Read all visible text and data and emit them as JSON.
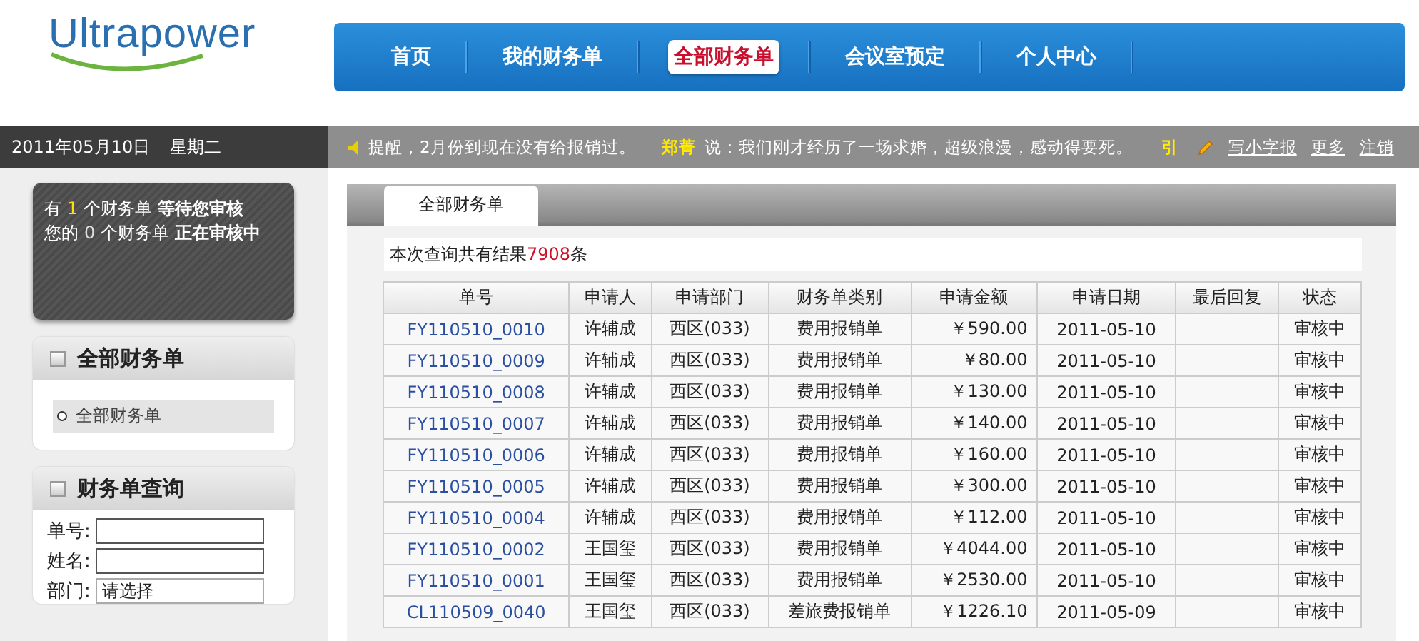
{
  "logo": {
    "text": "Ultrapower"
  },
  "nav": [
    {
      "label": "首页",
      "selected": false
    },
    {
      "label": "我的财务单",
      "selected": false
    },
    {
      "label": "全部财务单",
      "selected": true
    },
    {
      "label": "会议室预定",
      "selected": false
    },
    {
      "label": "个人中心",
      "selected": false
    }
  ],
  "date_bar": {
    "date": "2011年05月10日",
    "weekday": "星期二"
  },
  "notice": {
    "reminder": "提醒，2月份到现在没有给报销过。",
    "author": "郑菁",
    "message": "说：我们刚才经历了一场求婚，超级浪漫，感动得要死。",
    "marker": "引"
  },
  "notice_links": [
    "写小字报",
    "更多",
    "注销"
  ],
  "summary": [
    {
      "prefix": "有",
      "count": "1",
      "highlighted": true,
      "middle": "个财务单",
      "status": "等待您审核"
    },
    {
      "prefix": "您的",
      "count": "0",
      "highlighted": false,
      "middle": "个财务单",
      "status": "正在审核中"
    }
  ],
  "sidebar_all": {
    "title": "全部财务单",
    "items": [
      {
        "label": "全部财务单",
        "selected": true
      }
    ]
  },
  "sidebar_query": {
    "title": "财务单查询",
    "fields": [
      {
        "kind": "text",
        "label": "单号:"
      },
      {
        "kind": "text",
        "label": "姓名:"
      },
      {
        "kind": "select",
        "label": "部门:",
        "value": "请选择"
      }
    ]
  },
  "content": {
    "tab": "全部财务单",
    "result": {
      "prefix": "本次查询共有结果",
      "count": "7908",
      "suffix": "条"
    }
  },
  "table": {
    "columns": [
      "单号",
      "申请人",
      "申请部门",
      "财务单类别",
      "申请金额",
      "申请日期",
      "最后回复",
      "状态"
    ],
    "rows": [
      [
        "FY110510_0010",
        "许辅成",
        "西区(033)",
        "费用报销单",
        "￥590.00",
        "2011-05-10",
        "",
        "审核中"
      ],
      [
        "FY110510_0009",
        "许辅成",
        "西区(033)",
        "费用报销单",
        "￥80.00",
        "2011-05-10",
        "",
        "审核中"
      ],
      [
        "FY110510_0008",
        "许辅成",
        "西区(033)",
        "费用报销单",
        "￥130.00",
        "2011-05-10",
        "",
        "审核中"
      ],
      [
        "FY110510_0007",
        "许辅成",
        "西区(033)",
        "费用报销单",
        "￥140.00",
        "2011-05-10",
        "",
        "审核中"
      ],
      [
        "FY110510_0006",
        "许辅成",
        "西区(033)",
        "费用报销单",
        "￥160.00",
        "2011-05-10",
        "",
        "审核中"
      ],
      [
        "FY110510_0005",
        "许辅成",
        "西区(033)",
        "费用报销单",
        "￥300.00",
        "2011-05-10",
        "",
        "审核中"
      ],
      [
        "FY110510_0004",
        "许辅成",
        "西区(033)",
        "费用报销单",
        "￥112.00",
        "2011-05-10",
        "",
        "审核中"
      ],
      [
        "FY110510_0002",
        "王国玺",
        "西区(033)",
        "费用报销单",
        "￥4044.00",
        "2011-05-10",
        "",
        "审核中"
      ],
      [
        "FY110510_0001",
        "王国玺",
        "西区(033)",
        "费用报销单",
        "￥2530.00",
        "2011-05-10",
        "",
        "审核中"
      ],
      [
        "CL110509_0040",
        "王国玺",
        "西区(033)",
        "差旅费报销单",
        "￥1226.10",
        "2011-05-09",
        "",
        "审核中"
      ]
    ]
  }
}
